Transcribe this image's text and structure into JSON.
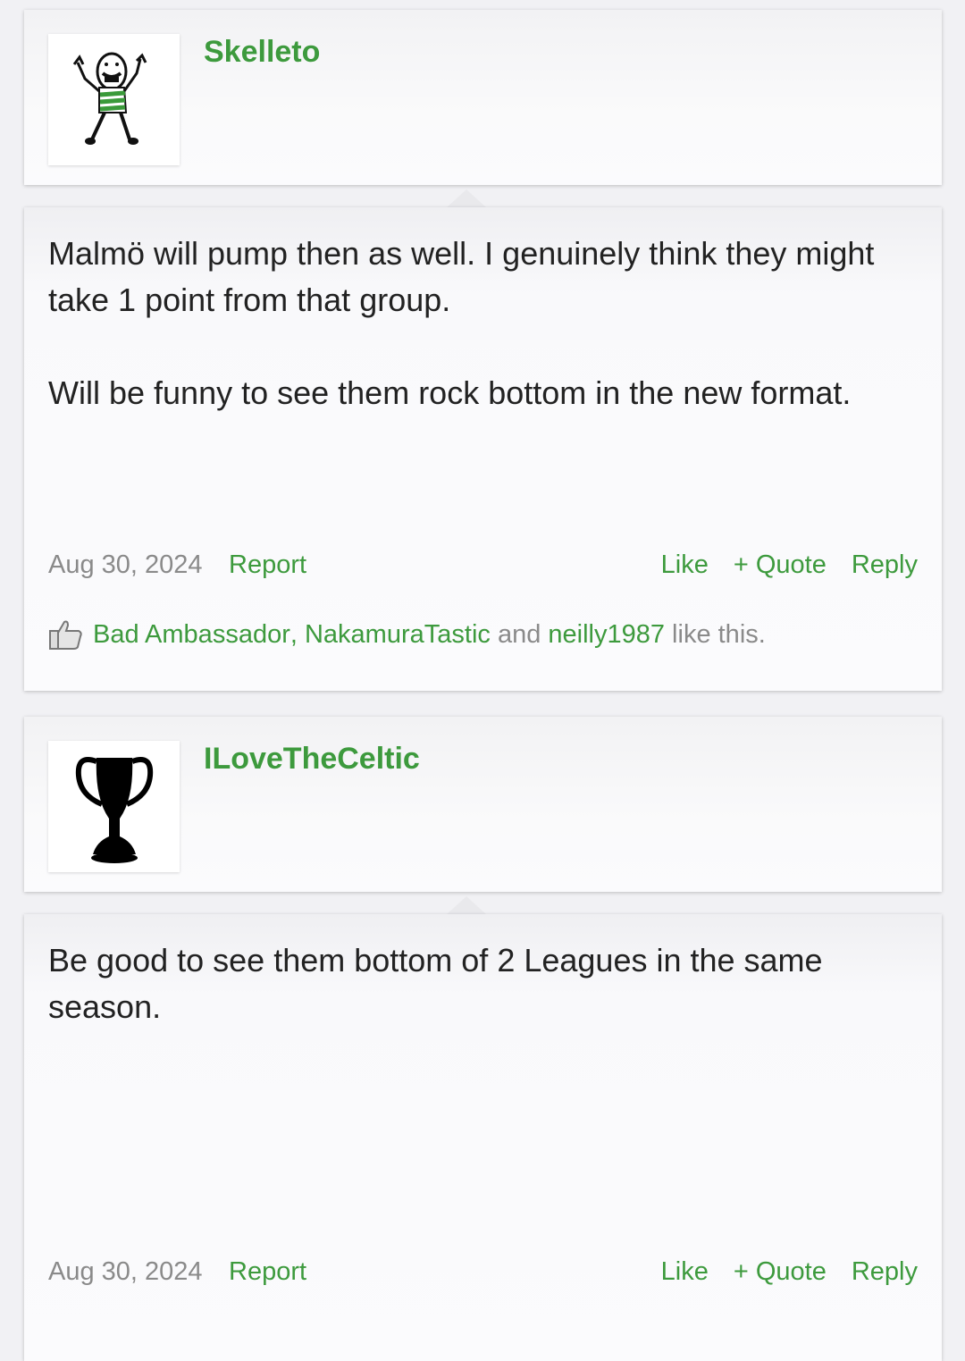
{
  "posts": [
    {
      "username": "Skelleto",
      "avatar_icon": "stick-figure-avatar-icon",
      "body": "Malmö will pump then as well. I genuinely think they might take 1 point from that group.\n\nWill be funny to see them rock bottom in the new format.",
      "date": "Aug 30, 2024",
      "report": "Report",
      "like": "Like",
      "quote": "+ Quote",
      "reply": "Reply",
      "likes": {
        "user1": "Bad Ambassador",
        "sep1": ", ",
        "user2": "NakamuraTastic",
        "sep2": " and ",
        "user3": "neilly1987",
        "suffix": " like this."
      }
    },
    {
      "username": "ILoveTheCeltic",
      "avatar_icon": "trophy-avatar-icon",
      "body": "Be good to see them bottom of 2 Leagues in the same season.",
      "date": "Aug 30, 2024",
      "report": "Report",
      "like": "Like",
      "quote": "+ Quote",
      "reply": "Reply"
    }
  ],
  "colors": {
    "accent": "#3d9a3d",
    "muted": "#8a8a8a"
  }
}
